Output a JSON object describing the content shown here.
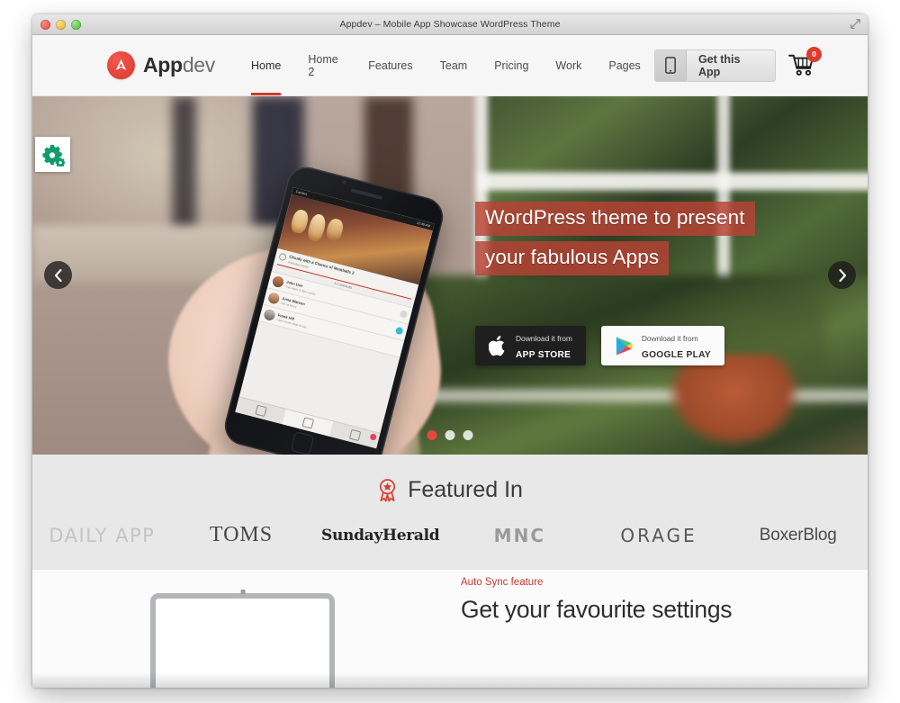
{
  "window": {
    "title": "Appdev – Mobile App Showcase WordPress Theme",
    "traffic_lights": [
      "close",
      "minimize",
      "zoom"
    ],
    "resize_icon": "resize-icon"
  },
  "header": {
    "brand": {
      "bold": "App",
      "light": "dev",
      "mark_icon": "appdev-logo-icon"
    },
    "nav": [
      {
        "label": "Home",
        "active": true
      },
      {
        "label": "Home 2",
        "active": false
      },
      {
        "label": "Features",
        "active": false
      },
      {
        "label": "Team",
        "active": false
      },
      {
        "label": "Pricing",
        "active": false
      },
      {
        "label": "Work",
        "active": false
      },
      {
        "label": "Pages",
        "active": false
      }
    ],
    "get_app_button": {
      "label": "Get this App",
      "icon": "mobile-phone-icon"
    },
    "cart": {
      "icon": "shopping-cart-icon",
      "count": "0",
      "badge_color": "#df3b2c"
    }
  },
  "hero": {
    "gear_widget": {
      "icon": "gear-icon",
      "color": "#0f9d6b"
    },
    "prev_arrow": "chevron-left-icon",
    "next_arrow": "chevron-right-icon",
    "headline_line1": "WordPress theme to present",
    "headline_line2": "your fabulous Apps",
    "headline_bg": "#ba4234",
    "stores": [
      {
        "icon": "apple-icon",
        "top": "Download it from",
        "bottom": "APP STORE",
        "style": "dark"
      },
      {
        "icon": "google-play-icon",
        "top": "Download it from",
        "bottom": "GOOGLE PLAY",
        "style": "light"
      }
    ],
    "slider_dots": [
      {
        "active": true
      },
      {
        "active": false
      },
      {
        "active": false
      }
    ],
    "active_dot_color": "#e5483a",
    "phone_screen": {
      "status_time": "12:45 AM",
      "status_label": "Carriers",
      "video_title": "Cloudy with a Chance of Meatballs 2",
      "video_subtitle": "Animated movie",
      "comments_header": "3 Comments",
      "comments": [
        {
          "name": "John Doe",
          "text": "This video is damn good"
        },
        {
          "name": "Anna Watson",
          "text": "Not so funny"
        },
        {
          "name": "Frank Hill",
          "text": "I don't know what to say"
        }
      ]
    }
  },
  "featured": {
    "title": "Featured In",
    "title_icon": "award-ribbon-icon",
    "logos": [
      {
        "name": "DAILY APP",
        "key": "daily"
      },
      {
        "name": "TOMS",
        "key": "toms"
      },
      {
        "name": "SundayHerald",
        "key": "sunday"
      },
      {
        "name": "MNC",
        "key": "mnc"
      },
      {
        "name": "ORAGE",
        "key": "orage"
      },
      {
        "name": "BoxerBlog",
        "key": "boxer"
      }
    ]
  },
  "lower": {
    "eyebrow": "Auto Sync feature",
    "eyebrow_color": "#c4392c",
    "heading": "Get your favourite settings",
    "device_icon": "laptop-outline-icon"
  }
}
